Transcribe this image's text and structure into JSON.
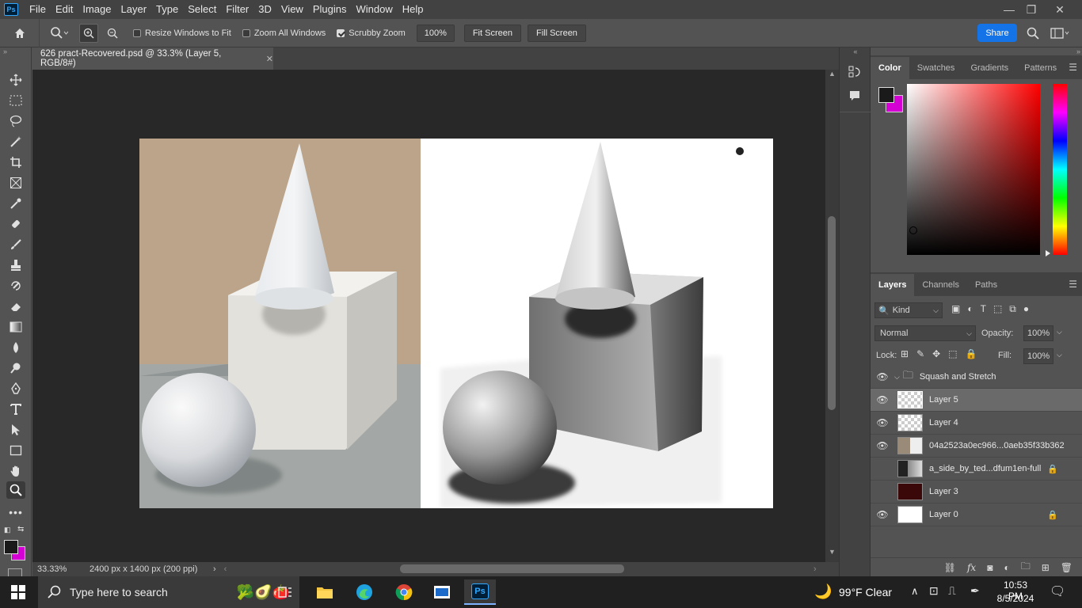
{
  "app": {
    "logo": "Ps"
  },
  "menu": [
    "File",
    "Edit",
    "Image",
    "Layer",
    "Type",
    "Select",
    "Filter",
    "3D",
    "View",
    "Plugins",
    "Window",
    "Help"
  ],
  "options": {
    "resize_windows": "Resize Windows to Fit",
    "zoom_all": "Zoom All Windows",
    "scrubby": "Scrubby Zoom",
    "zoom_value": "100%",
    "fit_screen": "Fit Screen",
    "fill_screen": "Fill Screen",
    "share": "Share"
  },
  "document": {
    "tab_title": "626 pract-Recovered.psd @ 33.3% (Layer 5, RGB/8#)",
    "zoom": "33.33%",
    "size": "2400 px x 1400 px (200 ppi)"
  },
  "color_panel": {
    "tabs": [
      "Color",
      "Swatches",
      "Gradients",
      "Patterns"
    ],
    "fg": "#1a1a1a",
    "bg": "#d400d4"
  },
  "layers_panel": {
    "tabs": [
      "Layers",
      "Channels",
      "Paths"
    ],
    "kind": "Kind",
    "blend": "Normal",
    "opacity_label": "Opacity:",
    "opacity": "100%",
    "lock_label": "Lock:",
    "fill_label": "Fill:",
    "fill": "100%",
    "group": "Squash and Stretch",
    "layers": [
      {
        "name": "Layer 5",
        "visible": true,
        "selected": true
      },
      {
        "name": "Layer 4",
        "visible": true
      },
      {
        "name": "04a2523a0ec966...0aeb35f33b362",
        "visible": true
      },
      {
        "name": "a_side_by_ted...dfum1en-full",
        "visible": false,
        "locked": true
      },
      {
        "name": "Layer 3",
        "visible": false
      },
      {
        "name": "Layer 0",
        "visible": true,
        "locked": true
      }
    ]
  },
  "taskbar": {
    "search_placeholder": "Type here to search",
    "weather": "99°F  Clear",
    "time": "10:53 PM",
    "date": "8/5/2024"
  }
}
